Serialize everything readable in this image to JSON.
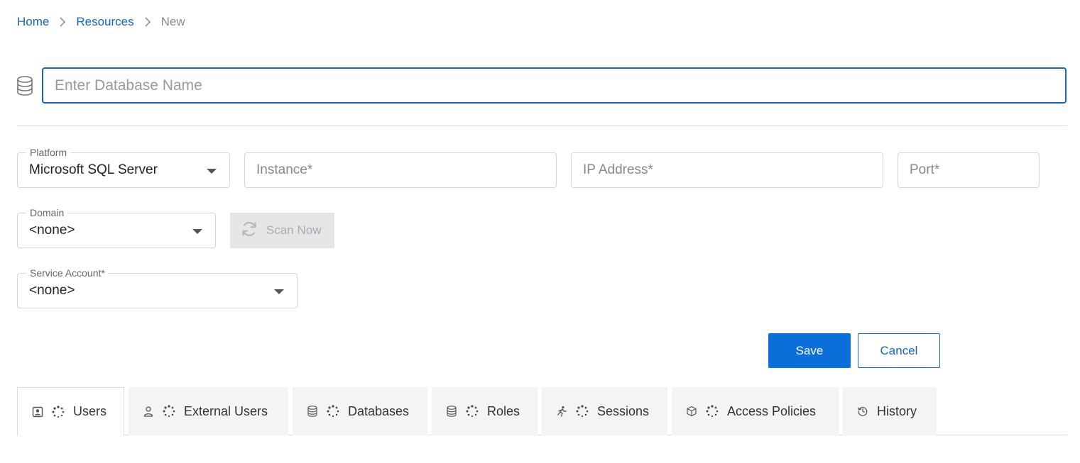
{
  "breadcrumb": {
    "items": [
      {
        "label": "Home",
        "link": true
      },
      {
        "label": "Resources",
        "link": true
      },
      {
        "label": "New",
        "link": false
      }
    ]
  },
  "name_input": {
    "placeholder": "Enter Database Name",
    "value": ""
  },
  "platform": {
    "legend": "Platform",
    "value": "Microsoft SQL Server"
  },
  "instance": {
    "placeholder": "Instance*",
    "value": ""
  },
  "ip_address": {
    "placeholder": "IP Address*",
    "value": ""
  },
  "port": {
    "placeholder": "Port*",
    "value": ""
  },
  "domain": {
    "legend": "Domain",
    "value": "<none>"
  },
  "scan_button": {
    "label": "Scan Now",
    "icon": "refresh-icon",
    "disabled": true
  },
  "service_account": {
    "legend": "Service Account*",
    "value": "<none>"
  },
  "actions": {
    "save_label": "Save",
    "cancel_label": "Cancel"
  },
  "tabs": [
    {
      "label": "Users",
      "icon": "user-card-icon",
      "loading": true,
      "active": true
    },
    {
      "label": "External Users",
      "icon": "person-icon",
      "loading": true,
      "active": false
    },
    {
      "label": "Databases",
      "icon": "database-icon",
      "loading": true,
      "active": false
    },
    {
      "label": "Roles",
      "icon": "database-icon",
      "loading": true,
      "active": false
    },
    {
      "label": "Sessions",
      "icon": "running-person-icon",
      "loading": true,
      "active": false
    },
    {
      "label": "Access Policies",
      "icon": "cube-icon",
      "loading": true,
      "active": false
    },
    {
      "label": "History",
      "icon": "history-icon",
      "loading": false,
      "active": false
    }
  ],
  "colors": {
    "primary": "#0a6fd8",
    "link": "#1565c0",
    "tab_bg": "#f2f4f5",
    "disabled_bg": "#e4e6e8"
  }
}
